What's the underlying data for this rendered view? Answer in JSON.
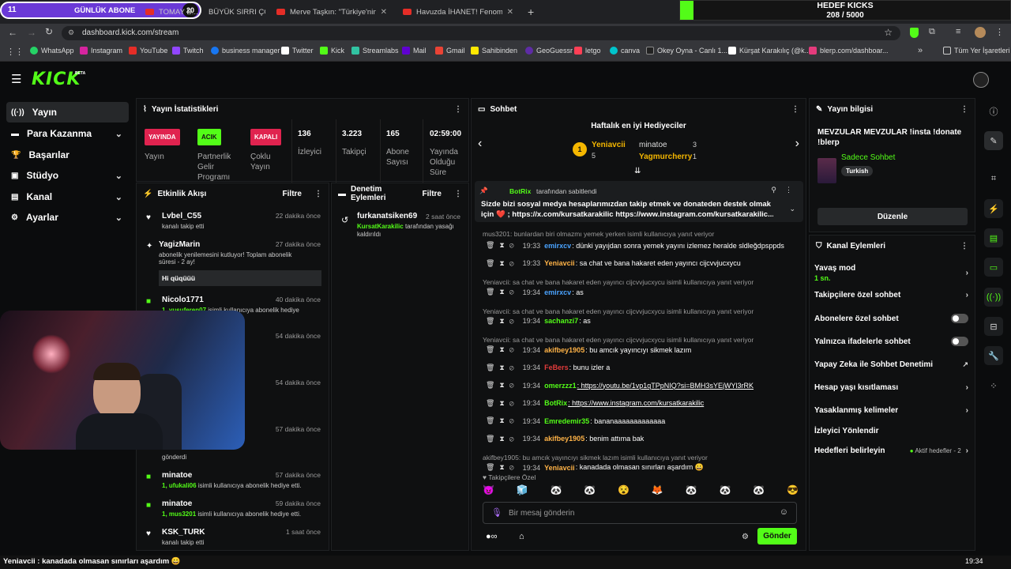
{
  "browser": {
    "tabs": [
      {
        "label": "GÜNLÜK ABONE",
        "type": "overlay"
      },
      {
        "label": "TOMAY B..."
      },
      {
        "label": "BÜYÜK SIRRI ÇÖZ"
      },
      {
        "label": "Merve Taşkın: \"Türkiye'nin Beni..."
      },
      {
        "label": "Havuzda İHANET! Fenomen AL..."
      }
    ],
    "url": "dashboard.kick.com/stream",
    "bookmarks": [
      "WhatsApp",
      "Instagram",
      "YouTube",
      "Twitch",
      "business manager",
      "Twitter",
      "Kick",
      "Streamlabs",
      "Mail",
      "Gmail",
      "Sahibinden",
      "GeoGuessr",
      "letgo",
      "canva",
      "Okey Oyna - Canlı 1...",
      "Kürşat Karakılıç (@k...",
      "blerp.com/dashboar..."
    ],
    "all_bookmarks": "Tüm Yer İşaretleri"
  },
  "overlay": {
    "ticker_left": "11",
    "ticker_label": "GÜNLÜK ABONE",
    "ticker_right": "20",
    "goal_title": "HEDEF KICKS",
    "goal_value": "208 / 5000",
    "goal_progress": 0.0416,
    "bottom_ticker": "Yeniavcii : kanadada olmasan sınırları aşardım 😀",
    "clock": "19:34"
  },
  "app": {
    "logo": "KICK",
    "logo_sup": "BETA"
  },
  "nav": [
    {
      "label": "Yayın",
      "icon": "broadcast-icon",
      "chev": ""
    },
    {
      "label": "Para Kazanma",
      "icon": "money-icon",
      "chev": "⌄"
    },
    {
      "label": "Başarılar",
      "icon": "trophy-icon",
      "chev": ""
    },
    {
      "label": "Stüdyo",
      "icon": "studio-icon",
      "chev": "⌄"
    },
    {
      "label": "Kanal",
      "icon": "channel-icon",
      "chev": "⌄"
    },
    {
      "label": "Ayarlar",
      "icon": "gear-icon",
      "chev": "⌄"
    }
  ],
  "stats": {
    "title": "Yayın İstatistikleri",
    "yayin_badge": "YAYINDA",
    "yayin_label": "Yayın",
    "partner_badge": "ACIK",
    "partner_label": "Partnerlik Gelir Programı",
    "coklu_badge": "KAPALI",
    "coklu_label": "Çoklu Yayın",
    "izleyici_val": "136",
    "izleyici_label": "İzleyici",
    "takipci_val": "3.223",
    "takipci_label": "Takipçi",
    "abone_val": "165",
    "abone_label": "Abone Sayısı",
    "sure_val": "02:59:00",
    "sure_label": "Yayında Olduğu Süre"
  },
  "activity": {
    "title": "Etkinlik Akışı",
    "filter": "Filtre",
    "items": [
      {
        "user": "Lvbel_C55",
        "time": "22 dakika önce",
        "desc": "kanalı takip etti"
      },
      {
        "user": "YagizMarin",
        "time": "27 dakika önce",
        "desc": "abonelik yenilemesini kutluyor! Toplam abonelik süresi - 2 ay!",
        "msg": "Hi qüqüüü"
      },
      {
        "user": "Nicolo1771",
        "time": "40 dakika önce",
        "desc_user": "1, yusuferen07",
        "desc": "isimli kullanıcıya abonelik hediye"
      },
      {
        "time": "54 dakika önce"
      },
      {
        "time": "54 dakika önce"
      },
      {
        "time": "57 dakika önce",
        "desc": "gönderdi"
      },
      {
        "user": "minatoe",
        "time": "57 dakika önce",
        "desc_user": "1, ufukali06",
        "desc": "isimli kullanıcıya abonelik hediye etti."
      },
      {
        "user": "minatoe",
        "time": "59 dakika önce",
        "desc_user": "1, mus3201",
        "desc": "isimli kullanıcıya abonelik hediye etti."
      },
      {
        "user": "KSK_TURK",
        "time": "1 saat önce",
        "desc": "kanalı takip etti"
      }
    ]
  },
  "moderation": {
    "title": "Denetim Eylemleri",
    "filter": "Filtre",
    "user": "furkanatsiken69",
    "time": "2 saat önce",
    "actor": "KursatKarakilic",
    "desc": "tarafından yasağı kaldırıldı"
  },
  "chat": {
    "title": "Sohbet",
    "gifters_title": "Haftalık en iyi Hediyeciler",
    "top1_name": "Yeniavcii",
    "top1_count": "5",
    "top2_name": "minatoe",
    "top2_count": "3",
    "top3_name": "Yagmurcherry",
    "top3_count": "1",
    "pinned_by": "BotRix",
    "pinned_suffix": "tarafından sabitlendi",
    "pinned_text1": "Sizde bizi sosyal medya hesaplarımızdan takip etmek ve donateden destek olmak",
    "pinned_text2": "için ❤️ ; https://x.com/kursatkarakilic https://www.instagram.com/kursatkarakilic...",
    "reply1": "mus3201: bunlardan biri olmazmı yemek yerken isimli kullanıcıya yanıt veriyor",
    "messages": [
      {
        "time": "19:33",
        "user": "emirxcv",
        "color": "#4aa3ff",
        "text": "dünki yayıjdan sonra yemek yayını izlemez heralde sldleğdpsppds"
      },
      {
        "time": "19:33",
        "user": "Yeniavcii",
        "color": "#ffb347",
        "text": "sa chat ve bana hakaret eden yayıncı cijcvvjucxycu"
      },
      {
        "reply": "Yeniavcii: sa chat ve bana hakaret eden yayıncı cijcvvjucxycu isimli kullanıcıya yanıt veriyor"
      },
      {
        "time": "19:34",
        "user": "emirxcv",
        "color": "#4aa3ff",
        "text": "as"
      },
      {
        "reply": "Yeniavcii: sa chat ve bana hakaret eden yayıncı cijcvvjucxycu isimli kullanıcıya yanıt veriyor"
      },
      {
        "time": "19:34",
        "user": "sachanzi7",
        "color": "#53fc18",
        "text": "as"
      },
      {
        "reply": "Yeniavcii: sa chat ve bana hakaret eden yayıncı cijcvvjucxycu isimli kullanıcıya yanıt veriyor"
      },
      {
        "time": "19:34",
        "user": "akifbey1905",
        "color": "#ffb347",
        "text": "bu amcık yayıncıyı sikmek lazım"
      },
      {
        "time": "19:34",
        "user": "FeBers",
        "color": "#e23b3b",
        "text": "bunu izler a"
      },
      {
        "time": "19:34",
        "user": "omerzzz1",
        "color": "#53fc18",
        "text": "https://youtu.be/1vp1qTPpNIQ?si=BMH3sYEjWYl3rRK"
      },
      {
        "time": "19:34",
        "user": "BotRix",
        "color": "#53fc18",
        "text": "https://www.instagram.com/kursatkarakilic"
      },
      {
        "time": "19:34",
        "user": "Emredemir35",
        "color": "#53fc18",
        "text": "bananaaaaaaaaaaaaa"
      },
      {
        "time": "19:34",
        "user": "akifbey1905",
        "color": "#ffb347",
        "text": "benim attıma bak"
      },
      {
        "reply": "akifbey1905: bu amcık yayıncıyı sikmek lazım isimli kullanıcıya yanıt veriyor"
      },
      {
        "time": "19:34",
        "user": "Yeniavcii",
        "color": "#ffb347",
        "text": "kanadada olmasan sınırları aşardım 😀"
      }
    ],
    "follower_only": "Takipçilere Özel",
    "input_placeholder": "Bir mesaj gönderin",
    "send": "Gönder"
  },
  "info": {
    "title": "Yayın bilgisi",
    "stream_title": "MEVZULAR MEVZULAR !insta !donate !blerp",
    "category": "Sadece Sohbet",
    "language": "Turkish",
    "edit": "Düzenle"
  },
  "channel_actions": {
    "title": "Kanal Eylemleri",
    "slow_mode": "Yavaş mod",
    "slow_value": "1 sn.",
    "followers_only": "Takipçilere özel sohbet",
    "subs_only": "Abonelere özel sohbet",
    "emotes_only": "Yalnızca ifadelerle sohbet",
    "ai_mod": "Yapay Zeka ile Sohbet Denetimi",
    "age_limit": "Hesap yaşı kısıtlaması",
    "banned_words": "Yasaklanmış kelimeler",
    "redirect": "İzleyici Yönlendir",
    "goals": "Hedefleri belirleyin",
    "goals_status": "Aktif hedefler - 2"
  },
  "colors": {
    "accent": "#53fc18",
    "live": "#e0234f",
    "off": "#e0234f"
  }
}
